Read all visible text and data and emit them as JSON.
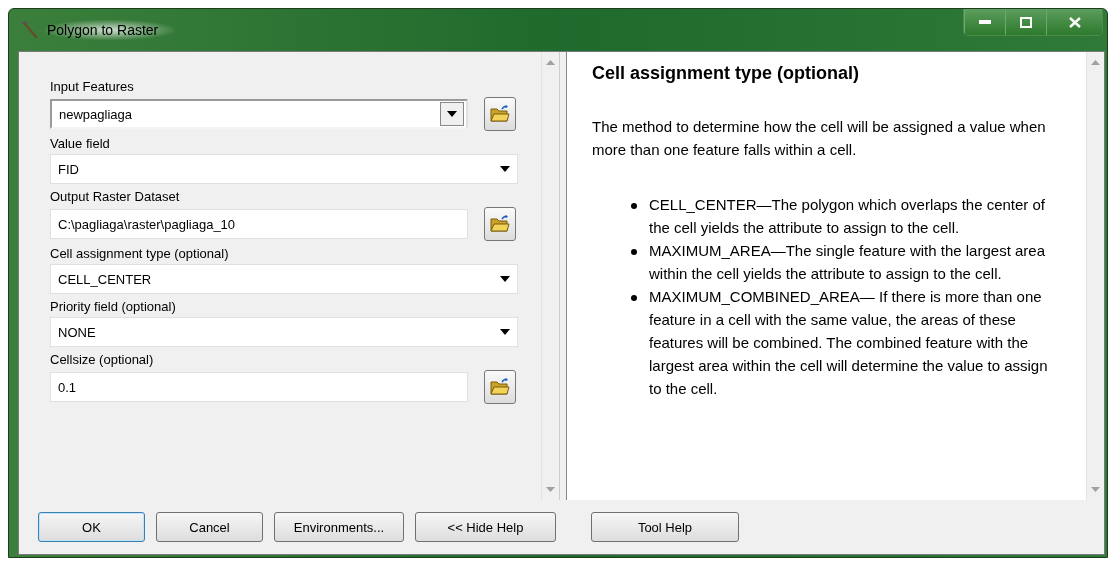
{
  "window": {
    "title": "Polygon to Raster"
  },
  "parameters": [
    {
      "label": "Input Features",
      "kind": "combo",
      "value": "newpagliaga"
    },
    {
      "label": "Value field",
      "kind": "dropdown",
      "value": "FID"
    },
    {
      "label": "Output Raster Dataset",
      "kind": "path",
      "value": "C:\\pagliaga\\raster\\pagliaga_10"
    },
    {
      "label": "Cell assignment type (optional)",
      "kind": "dropdown",
      "value": "CELL_CENTER"
    },
    {
      "label": "Priority field (optional)",
      "kind": "dropdown",
      "value": "NONE"
    },
    {
      "label": "Cellsize (optional)",
      "kind": "path",
      "value": "0.1"
    }
  ],
  "help": {
    "heading": "Cell assignment type (optional)",
    "intro": "The method to determine how the cell will be assigned a value when more than one feature falls within a cell.",
    "bullets": [
      "CELL_CENTER—The polygon which overlaps the center of the cell yields the attribute to assign to the cell.",
      "MAXIMUM_AREA—The single feature with the largest area within the cell yields the attribute to assign to the cell.",
      "MAXIMUM_COMBINED_AREA— If there is more than one feature in a cell with the same value, the areas of these features will be combined. The combined feature with the largest area within the cell will determine the value to assign to the cell."
    ]
  },
  "buttons": [
    {
      "label": "OK",
      "default": true
    },
    {
      "label": "Cancel",
      "default": false
    },
    {
      "label": "Environments...",
      "default": false
    },
    {
      "label": "<< Hide Help",
      "default": false
    }
  ],
  "help_buttons": [
    {
      "label": "Tool Help",
      "default": false
    }
  ]
}
